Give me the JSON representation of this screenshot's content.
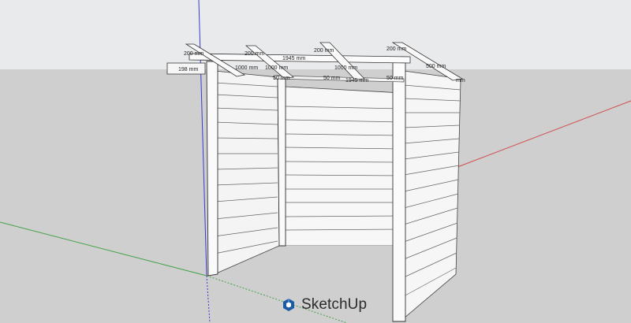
{
  "app": {
    "brand_name": "SketchUp",
    "brand_icon": "sketchup-logo-icon",
    "brand_color": "#1a5aa6"
  },
  "viewport": {
    "sky_color": "#e8eaec",
    "ground_color": "#cfcfcf"
  },
  "axes": {
    "red": "#d24a4a",
    "green": "#46a24a",
    "blue": "#3a3ad0"
  },
  "dimensions": {
    "d1": "200 mm",
    "d2": "200 mm",
    "d3": "200 mm",
    "d4": "200 mm",
    "d5": "198 mm",
    "d6": "1945 mm",
    "d7": "1000 mm",
    "d8": "1000 mm",
    "d9": "1000 mm",
    "d10": "500 mm",
    "d11": "1945 mm",
    "d12": "50 mm",
    "d13": "50 mm",
    "d14": "50 mm",
    "d15": "mm"
  }
}
